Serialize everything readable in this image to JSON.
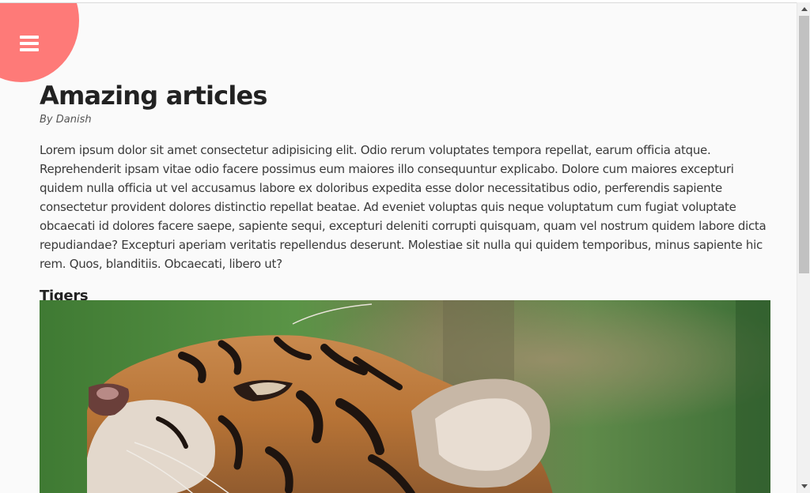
{
  "menu": {
    "icon": "hamburger-menu-icon",
    "color": "#fe7a78"
  },
  "article": {
    "title": "Amazing articles",
    "byline": "By Danish",
    "body": "Lorem ipsum dolor sit amet consectetur adipisicing elit. Odio rerum voluptates tempora repellat, earum officia atque. Reprehenderit ipsam vitae odio facere possimus eum maiores illo consequuntur explicabo. Dolore cum maiores excepturi quidem nulla officia ut vel accusamus labore ex doloribus expedita esse dolor necessitatibus odio, perferendis sapiente consectetur provident dolores distinctio repellat beatae. Ad eveniet voluptas quis neque voluptatum cum fugiat voluptate obcaecati id dolores facere saepe, sapiente sequi, excepturi deleniti corrupti quisquam, quam vel nostrum quidem labore dicta repudiandae? Excepturi aperiam veritatis repellendus deserunt. Molestiae sit nulla qui quidem temporibus, minus sapiente hic rem. Quos, blanditiis. Obcaecati, libero ut?",
    "section_heading": "Tigers",
    "image_subject": "tiger-photo"
  }
}
